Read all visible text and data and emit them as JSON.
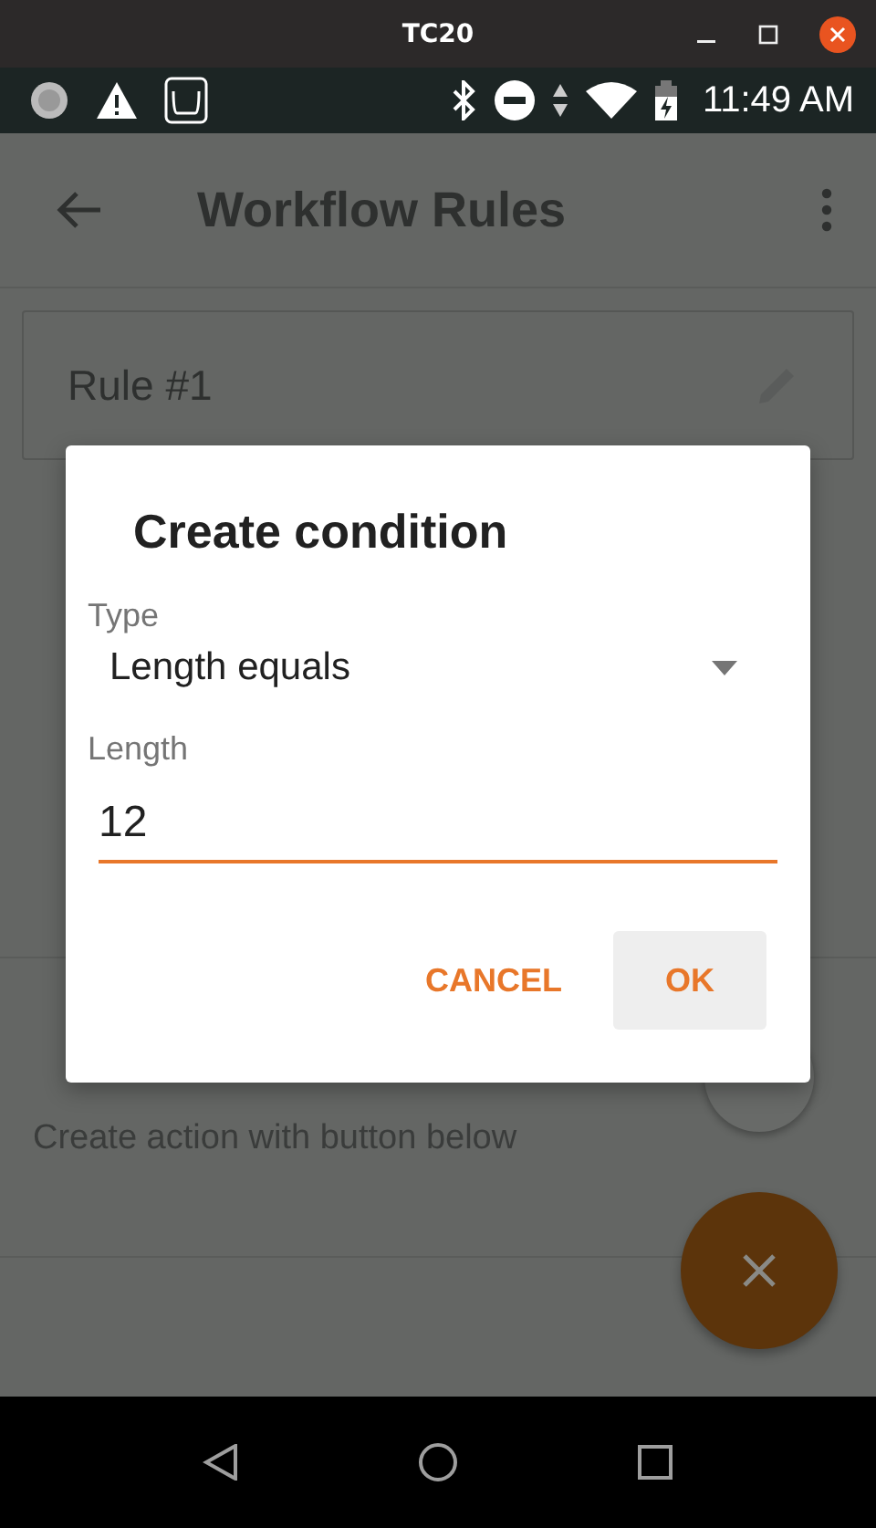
{
  "window": {
    "title": "TC20"
  },
  "status_bar": {
    "time": "11:49 AM"
  },
  "app_bar": {
    "title": "Workflow Rules"
  },
  "rule": {
    "name": "Rule #1"
  },
  "actions": {
    "hint": "Create action with button below"
  },
  "dialog": {
    "title": "Create condition",
    "fields": [
      {
        "kind": "select",
        "label": "Type",
        "value": "Length equals",
        "focused": false
      },
      {
        "kind": "text",
        "label": "Length",
        "value": "12",
        "focused": true
      }
    ],
    "buttons": [
      {
        "label": "CANCEL",
        "selected": false
      },
      {
        "label": "OK",
        "selected": true
      }
    ]
  }
}
